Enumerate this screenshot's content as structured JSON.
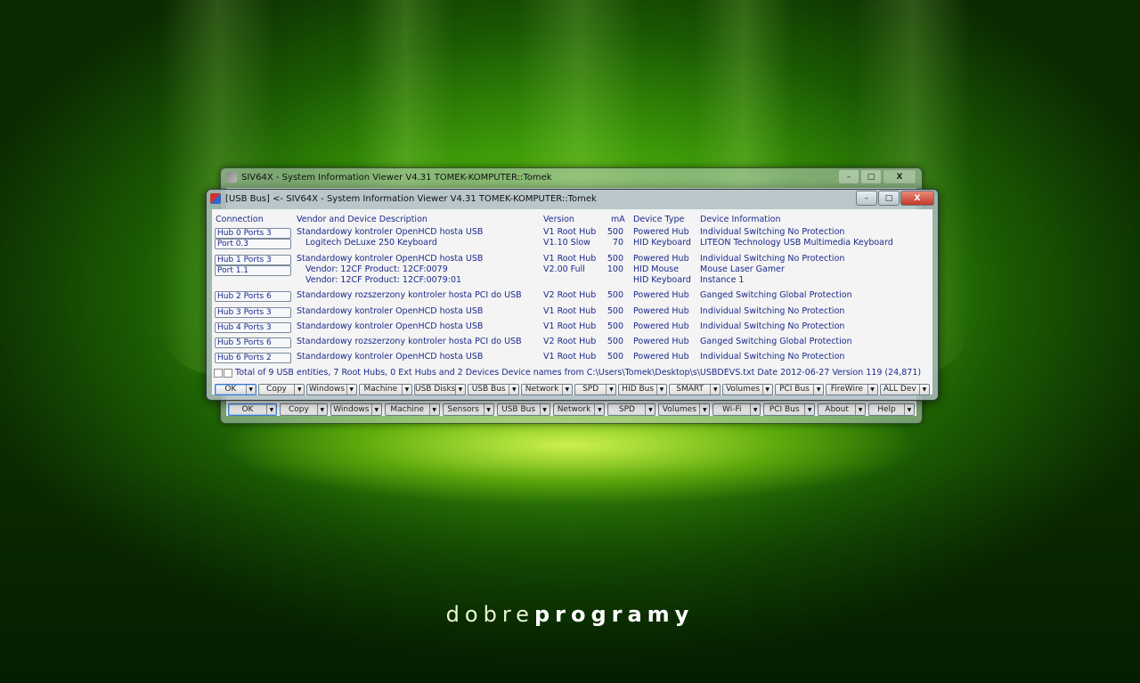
{
  "brand": {
    "light": "dobre",
    "bold": "programy"
  },
  "back_window": {
    "title": "SIV64X - System Information Viewer V4.31 TOMEK-KOMPUTER::Tomek",
    "buttons": [
      "OK",
      "Copy",
      "Windows",
      "Machine",
      "Sensors",
      "USB Bus",
      "Network",
      "SPD",
      "Volumes",
      "Wi-Fi",
      "PCI Bus",
      "About",
      "Help"
    ]
  },
  "front_window": {
    "title": "[USB Bus] <- SIV64X - System Information Viewer V4.31 TOMEK-KOMPUTER::Tomek",
    "controls": {
      "minimize": "–",
      "maximize": "□",
      "close": "X"
    },
    "columns": {
      "connection": "Connection",
      "vendor": "Vendor and Device Description",
      "version": "Version",
      "ma": "mA",
      "type": "Device Type",
      "info": "Device Information"
    },
    "rows": [
      {
        "conn": "Hub 0 Ports 3",
        "desc": "Standardowy kontroler OpenHCD hosta USB",
        "ver": "V1 Root Hub",
        "ma": "500",
        "type": "Powered Hub",
        "info": "Individual Switching  No Protection"
      },
      {
        "conn": "Port 0.3",
        "desc": "Logitech DeLuxe 250 Keyboard",
        "ver": "V1.10 Slow",
        "ma": "70",
        "type": "HID Keyboard",
        "info": "LITEON Technology USB Multimedia Keyboard"
      },
      {
        "conn": "Hub 1 Ports 3",
        "desc": "Standardowy kontroler OpenHCD hosta USB",
        "ver": "V1 Root Hub",
        "ma": "500",
        "type": "Powered Hub",
        "info": "Individual Switching  No Protection"
      },
      {
        "conn": "Port 1.1",
        "desc": "Vendor: 12CF Product: 12CF:0079",
        "ver": "V2.00 Full",
        "ma": "100",
        "type": "HID Mouse",
        "info": "Mouse Laser Gamer"
      },
      {
        "conn": "",
        "desc": "Vendor: 12CF Product: 12CF:0079:01",
        "ver": "",
        "ma": "",
        "type": "HID Keyboard",
        "info": "Instance 1"
      },
      {
        "conn": "Hub 2 Ports 6",
        "desc": "Standardowy rozszerzony kontroler hosta PCI do USB",
        "ver": "V2 Root Hub",
        "ma": "500",
        "type": "Powered Hub",
        "info": "Ganged Switching  Global Protection"
      },
      {
        "conn": "Hub 3 Ports 3",
        "desc": "Standardowy kontroler OpenHCD hosta USB",
        "ver": "V1 Root Hub",
        "ma": "500",
        "type": "Powered Hub",
        "info": "Individual Switching  No Protection"
      },
      {
        "conn": "Hub 4 Ports 3",
        "desc": "Standardowy kontroler OpenHCD hosta USB",
        "ver": "V1 Root Hub",
        "ma": "500",
        "type": "Powered Hub",
        "info": "Individual Switching  No Protection"
      },
      {
        "conn": "Hub 5 Ports 6",
        "desc": "Standardowy rozszerzony kontroler hosta PCI do USB",
        "ver": "V2 Root Hub",
        "ma": "500",
        "type": "Powered Hub",
        "info": "Ganged Switching  Global Protection"
      },
      {
        "conn": "Hub 6 Ports 2",
        "desc": "Standardowy kontroler OpenHCD hosta USB",
        "ver": "V1 Root Hub",
        "ma": "500",
        "type": "Powered Hub",
        "info": "Individual Switching  No Protection"
      }
    ],
    "status": "Total of 9 USB entities, 7 Root Hubs, 0 Ext Hubs and 2 Devices  Device names from C:\\Users\\Tomek\\Desktop\\s\\USBDEVS.txt  Date 2012-06-27 Version 119 (24,871)",
    "buttons": [
      "OK",
      "Copy",
      "Windows",
      "Machine",
      "USB Disks",
      "USB Bus",
      "Network",
      "SPD",
      "HID Bus",
      "SMART",
      "Volumes",
      "PCI Bus",
      "FireWire",
      "ALL Dev"
    ]
  }
}
